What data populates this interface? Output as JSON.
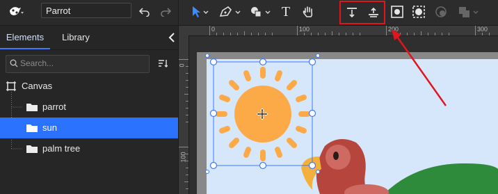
{
  "toolbar": {
    "document_name": "Parrot",
    "icons": [
      "logo-icon",
      "undo-icon",
      "redo-icon",
      "pointer-tool-icon",
      "pen-tool-icon",
      "shape-tool-icon",
      "text-tool-icon",
      "hand-tool-icon",
      "align-top-icon",
      "align-middle-icon",
      "fit-to-frame-icon",
      "group-select-icon",
      "mask-icon",
      "boolean-icon"
    ],
    "text_tool_label": "T",
    "highlight_color": "#e3141b"
  },
  "sidebar": {
    "tabs": [
      {
        "label": "Elements"
      },
      {
        "label": "Library"
      }
    ],
    "search_placeholder": "Search...",
    "tree": [
      {
        "label": "Canvas",
        "icon": "frame-icon"
      },
      {
        "label": "parrot",
        "icon": "folder-icon"
      },
      {
        "label": "sun",
        "icon": "folder-icon",
        "selected": true
      },
      {
        "label": "palm tree",
        "icon": "folder-icon"
      }
    ]
  },
  "rulers": {
    "top": [
      "0",
      "100",
      "200",
      "300"
    ],
    "left": [
      "0",
      "100"
    ]
  },
  "colors": {
    "accent": "#2b73ff",
    "sky": "#d6e7fb",
    "sun": "#fcaa48",
    "parrot": "#b5453d",
    "palm": "#2e8b3b"
  }
}
